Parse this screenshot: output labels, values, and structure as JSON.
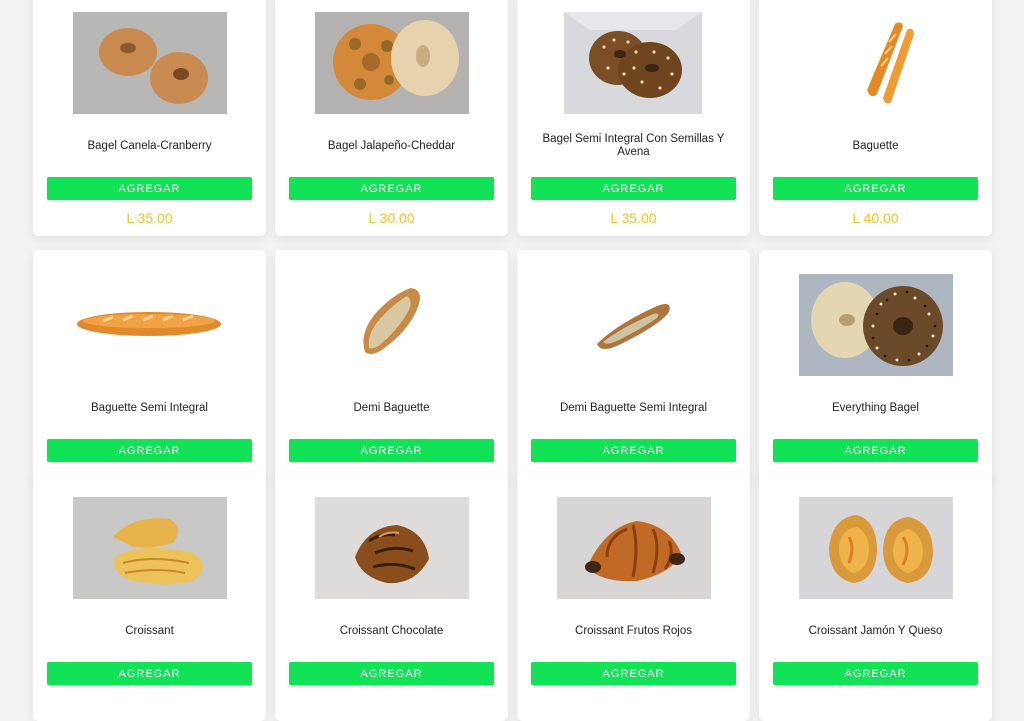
{
  "products": [
    {
      "name": "Bagel Canela-Cranberry",
      "button": "AGREGAR",
      "price": "L 35.00",
      "icon": "bagel-photo"
    },
    {
      "name": "Bagel Jalapeño-Cheddar",
      "button": "AGREGAR",
      "price": "L 30.00",
      "icon": "bagel-photo"
    },
    {
      "name": "Bagel Semi Integral Con Semillas Y Avena",
      "button": "AGREGAR",
      "price": "L 35.00",
      "icon": "bagel-photo"
    },
    {
      "name": "Baguette",
      "button": "AGREGAR",
      "price": "L 40.00",
      "icon": "baguette-photo"
    },
    {
      "name": "Baguette Semi Integral",
      "button": "AGREGAR",
      "icon": "baguette-photo"
    },
    {
      "name": "Demi Baguette",
      "button": "AGREGAR",
      "icon": "baguette-photo"
    },
    {
      "name": "Demi Baguette Semi Integral",
      "button": "AGREGAR",
      "icon": "baguette-photo"
    },
    {
      "name": "Everything Bagel",
      "button": "AGREGAR",
      "icon": "bagel-photo"
    },
    {
      "name": "Croissant",
      "button": "AGREGAR",
      "icon": "croissant-photo"
    },
    {
      "name": "Croissant Chocolate",
      "button": "AGREGAR",
      "icon": "croissant-photo"
    },
    {
      "name": "Croissant Frutos Rojos",
      "button": "AGREGAR",
      "icon": "croissant-photo"
    },
    {
      "name": "Croissant Jamón Y Queso",
      "button": "AGREGAR",
      "icon": "croissant-photo"
    }
  ],
  "colors": {
    "button": "#12e256",
    "price": "#f2c51b",
    "background": "#f3f3f4"
  }
}
